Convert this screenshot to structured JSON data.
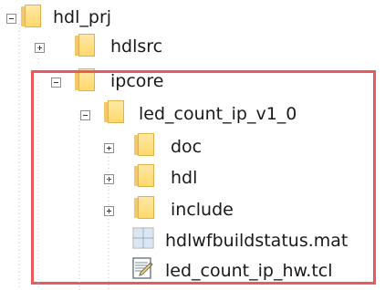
{
  "tree": {
    "items": [
      {
        "label": "hdl_prj",
        "type": "folder",
        "state": "collapse"
      },
      {
        "label": "hdlsrc",
        "type": "folder",
        "state": "expand"
      },
      {
        "label": "ipcore",
        "type": "folder",
        "state": "collapse"
      },
      {
        "label": "led_count_ip_v1_0",
        "type": "folder",
        "state": "collapse"
      },
      {
        "label": "doc",
        "type": "folder",
        "state": "expand"
      },
      {
        "label": "hdl",
        "type": "folder",
        "state": "expand"
      },
      {
        "label": "include",
        "type": "folder",
        "state": "expand"
      },
      {
        "label": "hdlwfbuildstatus.mat",
        "type": "mat-file"
      },
      {
        "label": "led_count_ip_hw.tcl",
        "type": "tcl-file"
      }
    ]
  },
  "highlight": {
    "color": "#e85a5e"
  }
}
